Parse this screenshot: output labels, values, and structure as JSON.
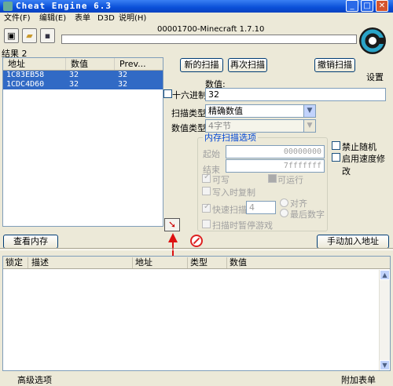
{
  "window": {
    "title": "Cheat Engine 6.3"
  },
  "menu": [
    "文件(F)",
    "编辑(E)",
    "表单",
    "D3D",
    "说明(H)"
  ],
  "toolbar": {
    "process_title": "00001700-Minecraft 1.7.10"
  },
  "settings_label": "设置",
  "results": {
    "count_label": "结果 2",
    "columns": [
      "地址",
      "数值",
      "Prev..."
    ],
    "rows": [
      {
        "address": "1C83EB58",
        "value": "32",
        "prev": "32"
      },
      {
        "address": "1CDC4D60",
        "value": "32",
        "prev": "32"
      }
    ]
  },
  "scan": {
    "new_scan": "新的扫描",
    "next_scan": "再次扫描",
    "undo_scan": "撤销扫描",
    "value_label": "数值:",
    "hex_label": "十六进制",
    "value": "32",
    "scan_type_label": "扫描类型",
    "scan_type": "精确数值",
    "value_type_label": "数值类型",
    "value_type": "4字节"
  },
  "memory_options": {
    "title": "内存扫描选项",
    "start_label": "起始",
    "start": "00000000",
    "end_label": "结束",
    "end": "7fffffff",
    "writable": "可写",
    "executable": "可运行",
    "copy_on_write": "写入时复制",
    "fast_scan": "快速扫描",
    "fast_scan_value": "4",
    "align": "对齐",
    "last_digits": "最后数字",
    "pause_game": "扫描时暂停游戏"
  },
  "side_options": {
    "disable_random": "禁止随机",
    "speedhack": "启用速度修改"
  },
  "buttons": {
    "view_memory": "查看内存",
    "add_address_manually": "手动加入地址"
  },
  "address_list": {
    "columns": [
      "锁定",
      "描述",
      "地址",
      "类型",
      "数值"
    ]
  },
  "status": {
    "advanced": "高级选项",
    "table_extras": "附加表单"
  }
}
